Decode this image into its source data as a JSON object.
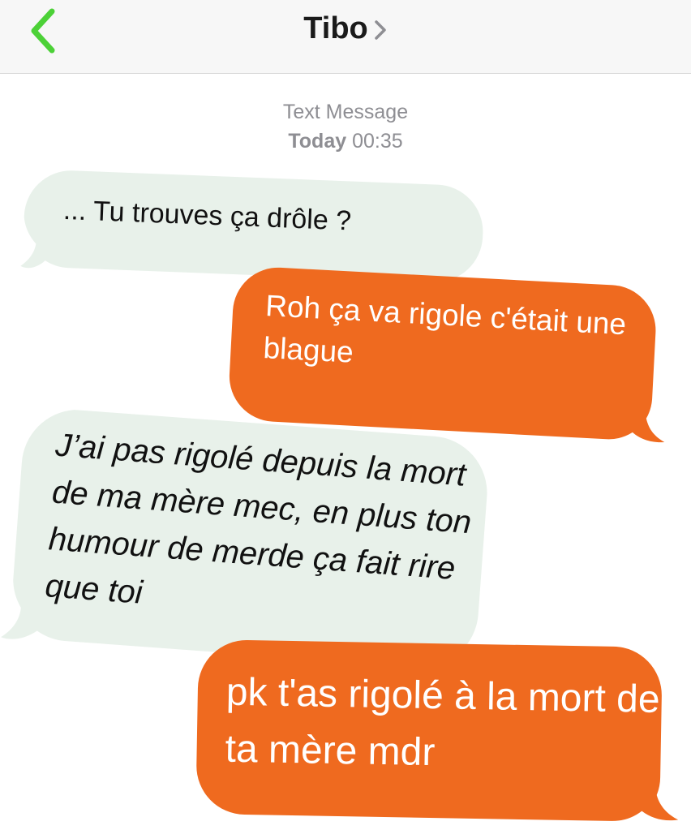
{
  "header": {
    "contact_name": "Tibo",
    "back_icon": "chevron-left-icon",
    "details_icon": "chevron-right-icon",
    "accent_color": "#4cd137"
  },
  "conversation": {
    "service_label": "Text Message",
    "date_label": "Today",
    "time_label": "00:35"
  },
  "colors": {
    "incoming_bubble": "#e8f1ea",
    "outgoing_bubble": "#ef6a1f"
  },
  "messages": [
    {
      "direction": "incoming",
      "text": "... Tu trouves ça drôle ?"
    },
    {
      "direction": "outgoing",
      "text": "Roh ça va rigole c'était une blague"
    },
    {
      "direction": "incoming",
      "text": "J’ai pas rigolé depuis la mort de ma mère mec, en plus ton humour de merde ça fait rire que toi"
    },
    {
      "direction": "outgoing",
      "text": "pk t'as rigolé à la mort de ta mère mdr"
    }
  ]
}
